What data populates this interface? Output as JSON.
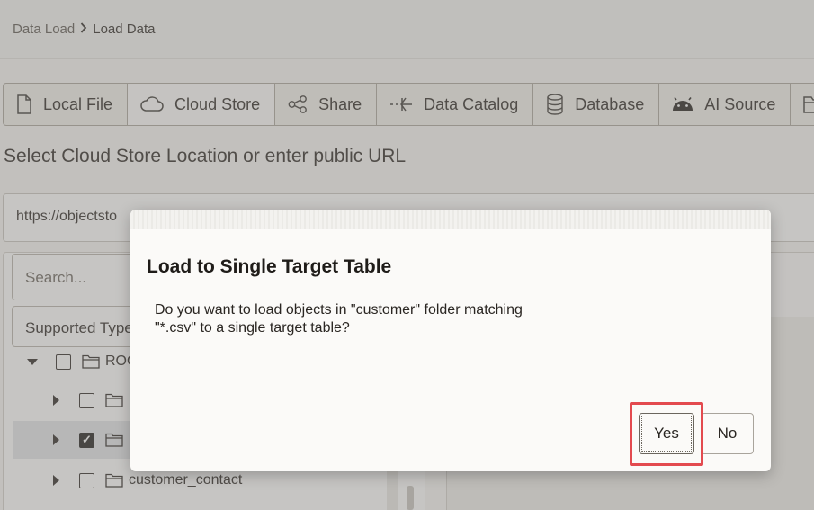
{
  "breadcrumb": {
    "root": "Data Load",
    "separator_icon": "chevron-right-icon",
    "current": "Load Data"
  },
  "tabs": [
    {
      "label": "Local File",
      "icon": "file-icon",
      "active": false
    },
    {
      "label": "Cloud Store",
      "icon": "cloud-icon",
      "active": true
    },
    {
      "label": "Share",
      "icon": "share-icon",
      "active": false
    },
    {
      "label": "Data Catalog",
      "icon": "catalog-icon",
      "active": false
    },
    {
      "label": "Database",
      "icon": "database-icon",
      "active": false
    },
    {
      "label": "AI Source",
      "icon": "android-icon",
      "active": false
    },
    {
      "label": "",
      "icon": "folder-icon",
      "active": false
    }
  ],
  "section_title": "Select Cloud Store Location or enter public URL",
  "url_field": {
    "value": "https://objectsto"
  },
  "left_panel": {
    "search_placeholder": "Search...",
    "types_select": "Supported Type",
    "tree": [
      {
        "label": "ROO",
        "expanded": true,
        "checked": false
      },
      {
        "label": "",
        "expanded": false,
        "checked": false
      },
      {
        "label": "",
        "expanded": false,
        "checked": true,
        "selected": true
      },
      {
        "label": "customer_contact",
        "expanded": false,
        "checked": false
      }
    ]
  },
  "dialog": {
    "title": "Load to Single Target Table",
    "message_line1": "Do you want to load objects in \"customer\" folder matching",
    "message_line2": "\"*.csv\" to a single target table?",
    "yes_label": "Yes",
    "no_label": "No"
  },
  "colors": {
    "highlight": "#e34a4f",
    "overlay": "#807e7a"
  }
}
